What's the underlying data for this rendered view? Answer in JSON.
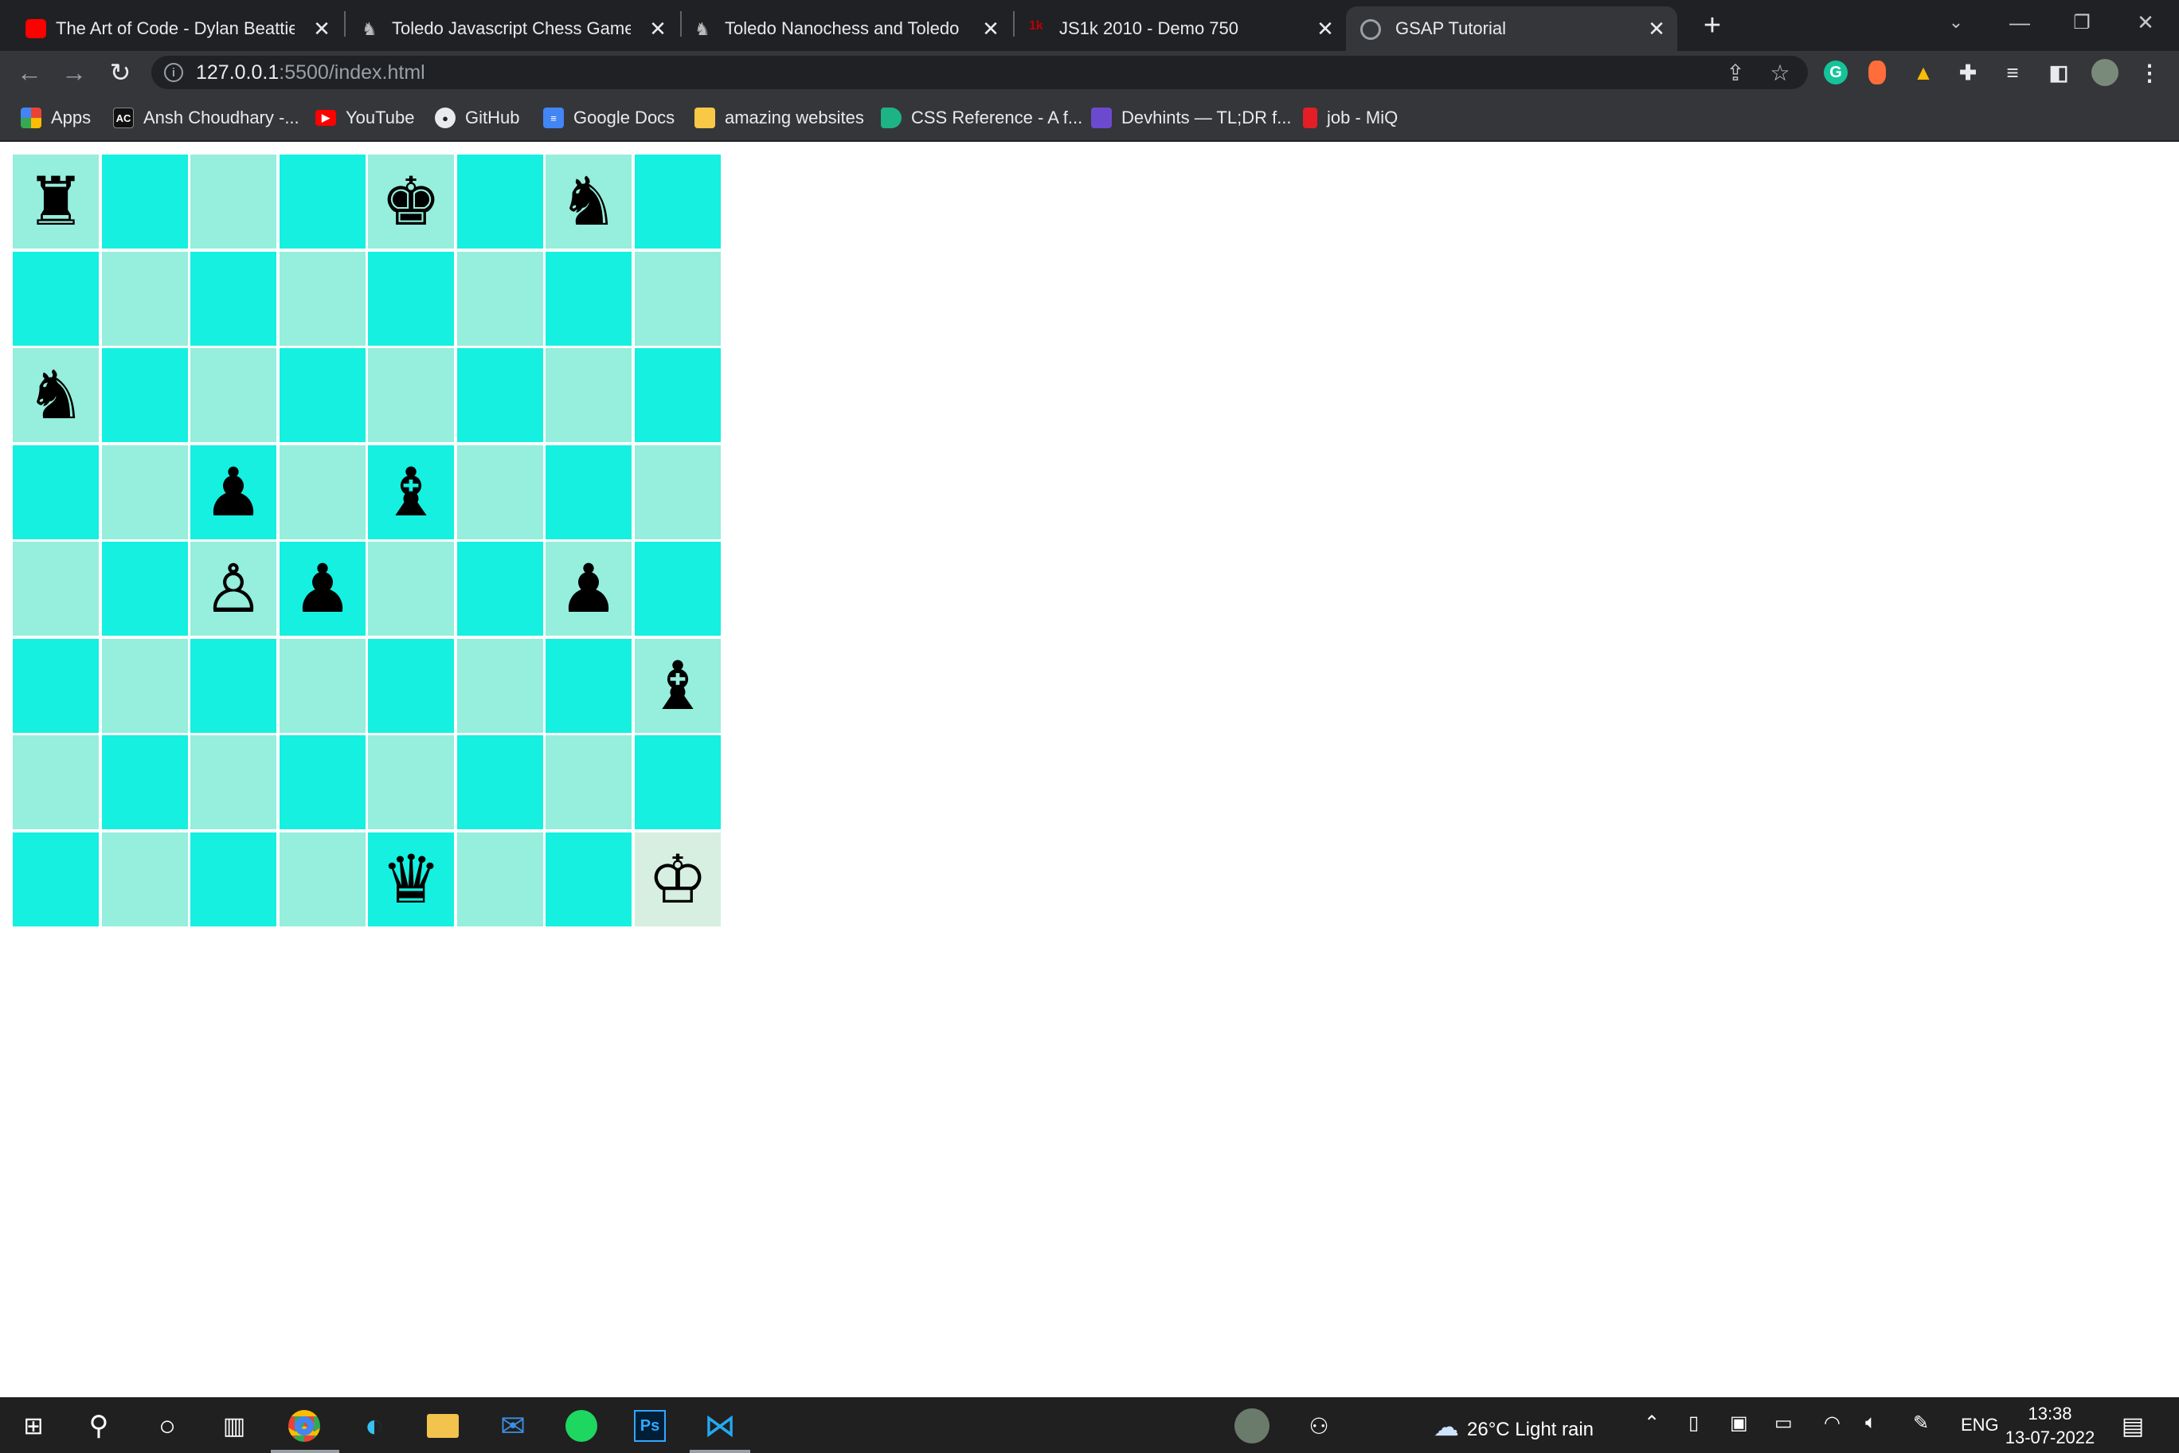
{
  "browser": {
    "tabs": [
      {
        "title": "The Art of Code - Dylan Beattie -",
        "favicon": "youtube-icon",
        "active": false
      },
      {
        "title": "Toledo Javascript Chess Game",
        "favicon": "knight-icon",
        "active": false
      },
      {
        "title": "Toledo Nanochess and Toledo Pi",
        "favicon": "knight-icon",
        "active": false
      },
      {
        "title": "JS1k 2010 - Demo 750",
        "favicon": "js1k-icon",
        "active": false
      },
      {
        "title": "GSAP Tutorial",
        "favicon": "globe-icon",
        "active": true
      }
    ],
    "url_host": "127.0.0.1",
    "url_path": ":5500/index.html",
    "bookmarks": [
      {
        "label": "Apps",
        "icon": "apps-grid-icon"
      },
      {
        "label": "Ansh Choudhary -...",
        "icon": "ac-icon"
      },
      {
        "label": "YouTube",
        "icon": "youtube-icon"
      },
      {
        "label": "GitHub",
        "icon": "github-icon"
      },
      {
        "label": "Google Docs",
        "icon": "docs-icon"
      },
      {
        "label": "amazing websites",
        "icon": "folder-icon"
      },
      {
        "label": "CSS Reference - A f...",
        "icon": "css-icon"
      },
      {
        "label": "Devhints — TL;DR f...",
        "icon": "devhints-icon"
      },
      {
        "label": "job - MiQ",
        "icon": "bookmark-red-icon"
      }
    ],
    "extension_grammarly": "G"
  },
  "board": {
    "rows": [
      [
        "♜",
        "",
        "",
        "",
        "♚",
        "",
        "♞",
        ""
      ],
      [
        "",
        "",
        "",
        "",
        "",
        "",
        "",
        ""
      ],
      [
        "♞",
        "",
        "",
        "",
        "",
        "",
        "",
        ""
      ],
      [
        "",
        "",
        "♟",
        "",
        "♝",
        "",
        "",
        ""
      ],
      [
        "",
        "",
        "♙",
        "♟",
        "",
        "",
        "♟",
        ""
      ],
      [
        "",
        "",
        "",
        "",
        "",
        "",
        "",
        "♝"
      ],
      [
        "",
        "",
        "",
        "",
        "",
        "",
        "",
        ""
      ],
      [
        "",
        "",
        "",
        "",
        "♛",
        "",
        "",
        "♔"
      ]
    ],
    "light_color": "#96eedc",
    "dark_color": "#15f0e0",
    "selected_color": "#d6efe0",
    "selected_square": "h1"
  },
  "taskbar": {
    "weather": "26°C  Light rain",
    "language": "ENG",
    "time": "13:38",
    "date": "13-07-2022",
    "photoshop_label": "Ps"
  }
}
